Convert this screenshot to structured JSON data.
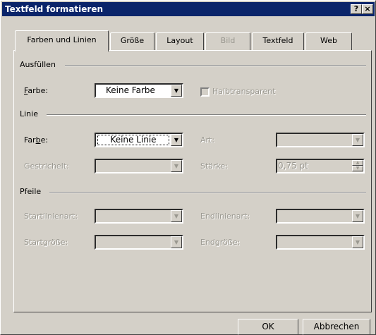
{
  "window": {
    "title": "Textfeld formatieren",
    "help_glyph": "?",
    "close_glyph": "×"
  },
  "tabs": [
    {
      "label": "Farben und Linien",
      "state": "active"
    },
    {
      "label": "Größe",
      "state": "normal"
    },
    {
      "label": "Layout",
      "state": "normal"
    },
    {
      "label": "Bild",
      "state": "disabled"
    },
    {
      "label": "Textfeld",
      "state": "normal"
    },
    {
      "label": "Web",
      "state": "normal"
    }
  ],
  "fill": {
    "heading": "Ausfüllen",
    "color_label": "Farbe:",
    "color_value": "Keine Farbe",
    "semitransparent_label": "Halbtransparent",
    "semitransparent_checked": false
  },
  "line": {
    "heading": "Linie",
    "color_label": "Farbe:",
    "color_value": "Keine Linie",
    "style_label": "Art:",
    "dashed_label": "Gestrichelt:",
    "weight_label": "Stärke:",
    "weight_value": "0,75 pt"
  },
  "arrows": {
    "heading": "Pfeile",
    "start_style_label": "Startlinienart:",
    "end_style_label": "Endlinienart:",
    "start_size_label": "Startgröße:",
    "end_size_label": "Endgröße:"
  },
  "buttons": {
    "ok": "OK",
    "cancel": "Abbrechen"
  },
  "icons": {
    "dropdown": "chevron-down-icon",
    "spin_up": "spin-up-icon",
    "spin_down": "spin-down-icon"
  }
}
